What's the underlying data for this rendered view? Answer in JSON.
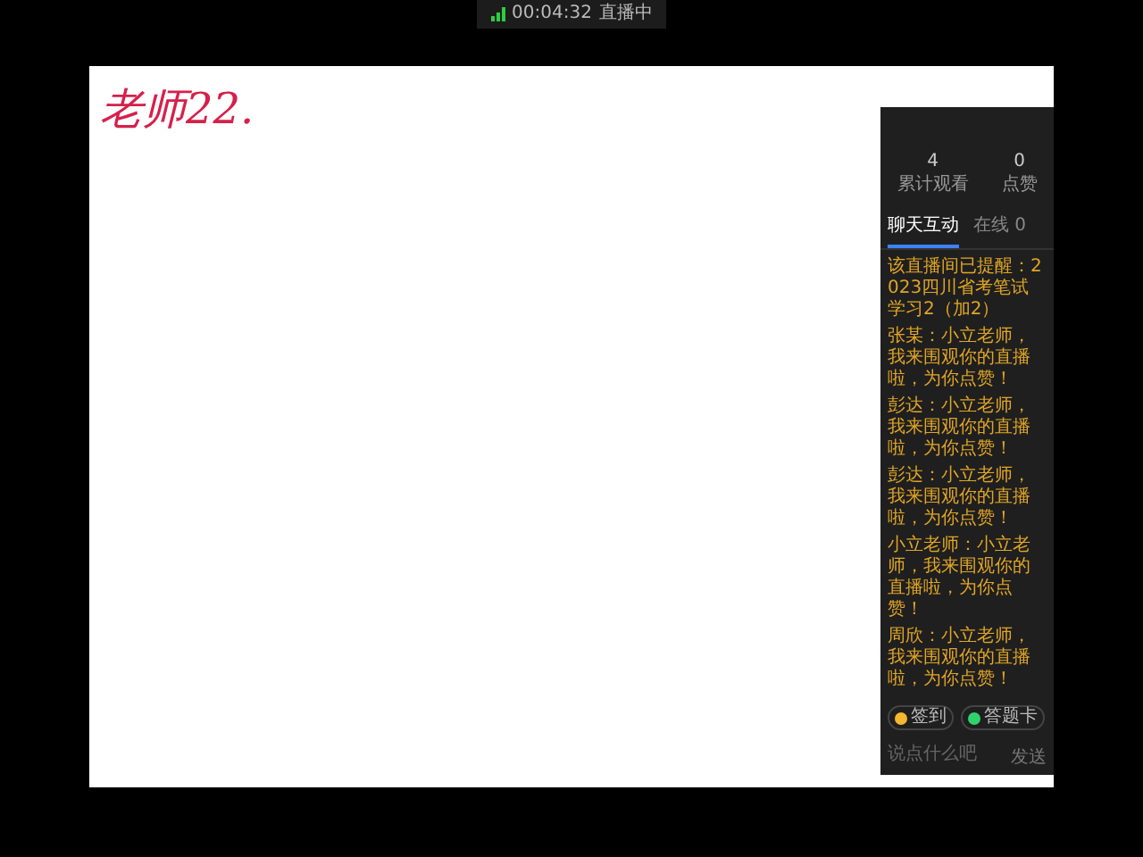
{
  "status": {
    "time": "00:04:32",
    "label": "直播中"
  },
  "whiteboard": {
    "handwriting": "老师22."
  },
  "panel": {
    "stats": [
      {
        "value": "4",
        "label": "累计观看"
      },
      {
        "value": "0",
        "label": "点赞"
      }
    ],
    "tabs": [
      {
        "label": "聊天互动",
        "selected": true
      },
      {
        "label": "在线 0",
        "selected": false
      }
    ],
    "messages": [
      "该直播间已提醒：2023四川省考笔试学习2（加2）",
      "张某：小立老师，我来围观你的直播啦，为你点赞！",
      "彭达：小立老师，我来围观你的直播啦，为你点赞！",
      "彭达：小立老师，我来围观你的直播啦，为你点赞！",
      "小立老师：小立老师，我来围观你的直播啦，为你点赞！",
      "周欣：小立老师，我来围观你的直播啦，为你点赞！"
    ],
    "actions": [
      {
        "label": "签到",
        "color": "#f5b731"
      },
      {
        "label": "答题卡",
        "color": "#2fd36b"
      }
    ],
    "input": {
      "placeholder": "说点什么吧"
    },
    "send": "发送"
  }
}
